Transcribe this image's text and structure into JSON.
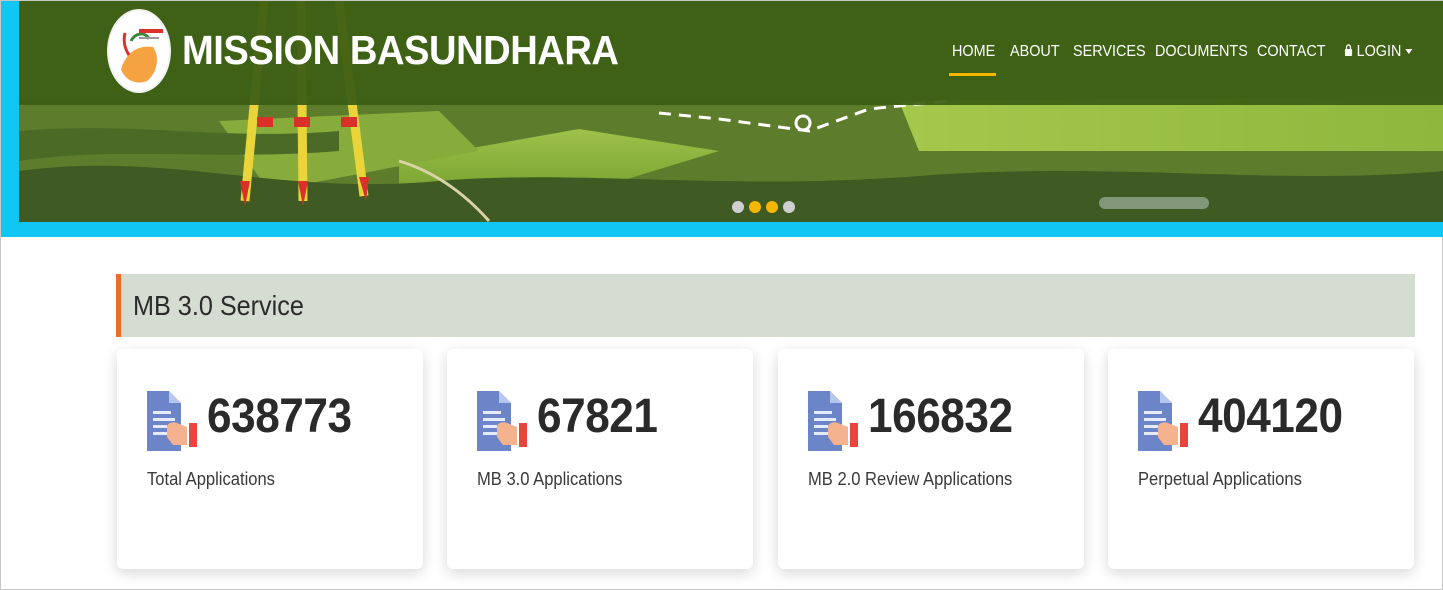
{
  "header": {
    "brand_name": "MISSION BASUNDHARA",
    "nav": [
      {
        "label": "HOME",
        "active": true
      },
      {
        "label": "ABOUT",
        "active": false
      },
      {
        "label": "SERVICES",
        "active": false
      },
      {
        "label": "DOCUMENTS",
        "active": false
      },
      {
        "label": "CONTACT",
        "active": false
      },
      {
        "label": "LOGIN",
        "active": false,
        "icon": "lock-icon",
        "dropdown": true
      }
    ]
  },
  "carousel": {
    "slides": 4,
    "active_slide": 2,
    "dot_colors": [
      "#cfcfcf",
      "#f5b600",
      "#f5b600",
      "#cfcfcf"
    ]
  },
  "section": {
    "title": "MB 3.0 Service"
  },
  "cards": [
    {
      "value": "638773",
      "label": "Total Applications",
      "icon": "document-hand-icon"
    },
    {
      "value": "67821",
      "label": "MB 3.0 Applications",
      "icon": "document-hand-icon"
    },
    {
      "value": "166832",
      "label": "MB 2.0 Review Applications",
      "icon": "document-hand-icon"
    },
    {
      "value": "404120",
      "label": "Perpetual Applications",
      "icon": "document-hand-icon"
    }
  ],
  "colors": {
    "topbar": "#3a5c12",
    "accent_strip": "#0fc7f2",
    "nav_active_underline": "#f5b600",
    "section_bar": "#d5dcd1",
    "section_accent": "#ef6b2a"
  }
}
